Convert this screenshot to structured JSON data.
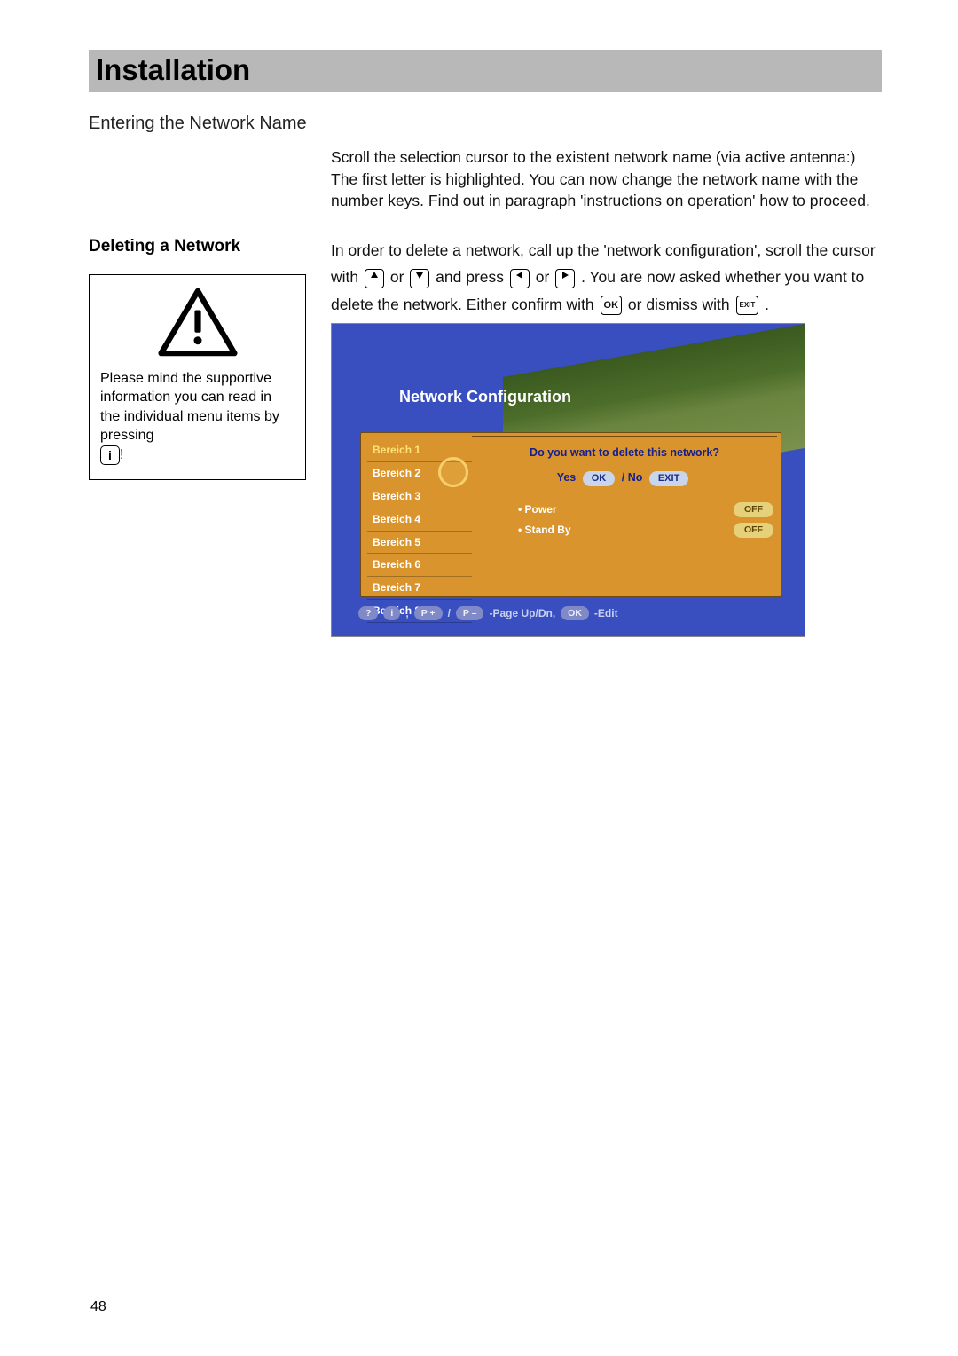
{
  "header": {
    "title": "Installation"
  },
  "section1": {
    "subtitle": "Entering the Network Name",
    "body": "Scroll the selection cursor to the existent network name (via active antenna:) The first letter is highlighted. You can now change the network name with the number keys. Find out in paragraph 'instructions on operation' how to proceed."
  },
  "section2": {
    "title": "Deleting a Network",
    "warn_text": "Please mind the supportive information you can read in the individual menu items by pressing",
    "warn_info_suffix": "!",
    "para_a": "In order to delete a network, call up the 'network configuration', scroll the cursor with ",
    "para_b": " or ",
    "para_c": " and press ",
    "para_d": " or ",
    "para_e": ". You are now asked whether you want to delete the network. Either confirm with ",
    "para_f": " or dismiss with ",
    "para_g": ".",
    "key_ok": "OK",
    "key_exit": "EXIT",
    "key_info": "i"
  },
  "tv": {
    "title": "Network Configuration",
    "bereich": [
      "Bereich 1",
      "Bereich 2",
      "Bereich 3",
      "Bereich 4",
      "Bereich 5",
      "Bereich 6",
      "Bereich 7",
      "Bereich 8"
    ],
    "dialog_q": "Do you want to delete this network?",
    "yes": "Yes",
    "no": "No",
    "ok": "OK",
    "exit": "EXIT",
    "rows": [
      {
        "label": "Power",
        "value": "OFF"
      },
      {
        "label": "Stand By",
        "value": "OFF"
      }
    ],
    "hint_pplus": "P +",
    "hint_pminus": "P –",
    "hint_text1": "-Page Up/Dn,",
    "hint_text2": "-Edit",
    "hint_i": "i",
    "hint_q": "?",
    "hint_ok": "OK"
  },
  "page_number": "48"
}
